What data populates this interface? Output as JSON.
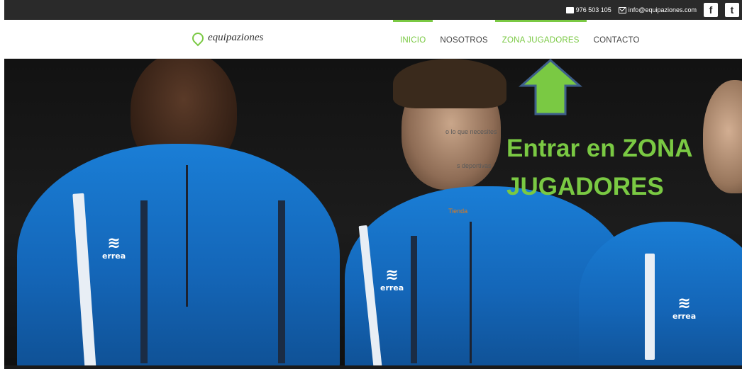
{
  "topbar": {
    "phone": "976 503 105",
    "email": "info@equipaziones.com",
    "phone_icon": "phone-icon",
    "email_icon": "mail-icon",
    "facebook_label": "f",
    "twitter_label": "t"
  },
  "header": {
    "logo_text": "equipaziones",
    "logo_icon": "leaf-logo-icon"
  },
  "nav": {
    "items": [
      {
        "label": "INICIO"
      },
      {
        "label": "NOSOTROS"
      },
      {
        "label": "ZONA JUGADORES"
      },
      {
        "label": "CONTACTO"
      }
    ],
    "accent_color": "#7ac943"
  },
  "hero": {
    "line1": "o lo que necesites",
    "line2": "s deportivas",
    "link": "Tienda",
    "badge_text": "errea"
  },
  "callout": {
    "line1": "Entrar en ZONA",
    "line2": "JUGADORES",
    "color": "#7ac943",
    "arrow_icon": "arrow-up-icon"
  }
}
